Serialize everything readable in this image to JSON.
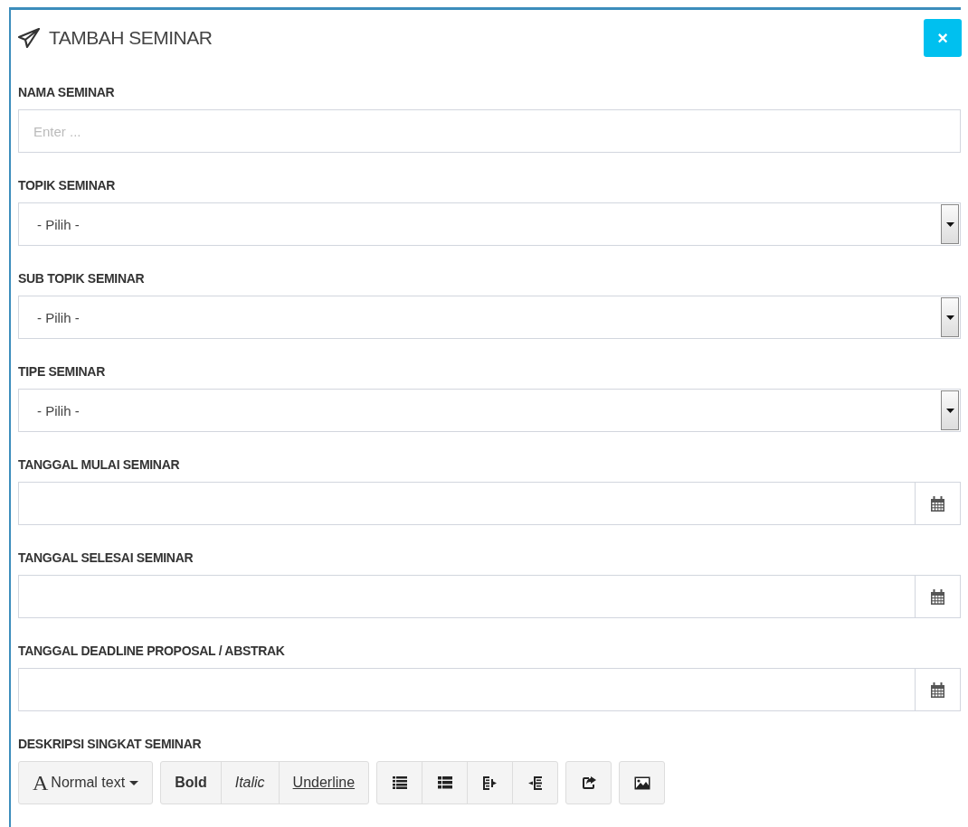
{
  "panel": {
    "title": "TAMBAH SEMINAR",
    "close_button": "×"
  },
  "fields": [
    {
      "kind": "text",
      "label": "NAMA SEMINAR",
      "placeholder": "Enter ..."
    },
    {
      "kind": "select",
      "label": "TOPIK SEMINAR",
      "value": "- Pilih -"
    },
    {
      "kind": "select",
      "label": "SUB TOPIK SEMINAR",
      "value": "- Pilih -"
    },
    {
      "kind": "select",
      "label": "TIPE SEMINAR",
      "value": "- Pilih -"
    },
    {
      "kind": "date",
      "label": "TANGGAL MULAI SEMINAR"
    },
    {
      "kind": "date",
      "label": "TANGGAL SELESAI SEMINAR"
    },
    {
      "kind": "date",
      "label": "TANGGAL DEADLINE PROPOSAL / ABSTRAK"
    }
  ],
  "editor": {
    "label": "DESKRIPSI SINGKAT SEMINAR",
    "toolbar": [
      [
        {
          "kind": "font",
          "glyph": "A",
          "label": "Normal text"
        }
      ],
      [
        {
          "kind": "bold",
          "label": "Bold"
        },
        {
          "kind": "italic",
          "label": "Italic"
        },
        {
          "kind": "underline",
          "label": "Underline"
        }
      ],
      [
        {
          "kind": "bullet-list"
        },
        {
          "kind": "numbered-list"
        },
        {
          "kind": "outdent"
        },
        {
          "kind": "indent"
        }
      ],
      [
        {
          "kind": "link"
        }
      ],
      [
        {
          "kind": "image"
        }
      ]
    ]
  }
}
